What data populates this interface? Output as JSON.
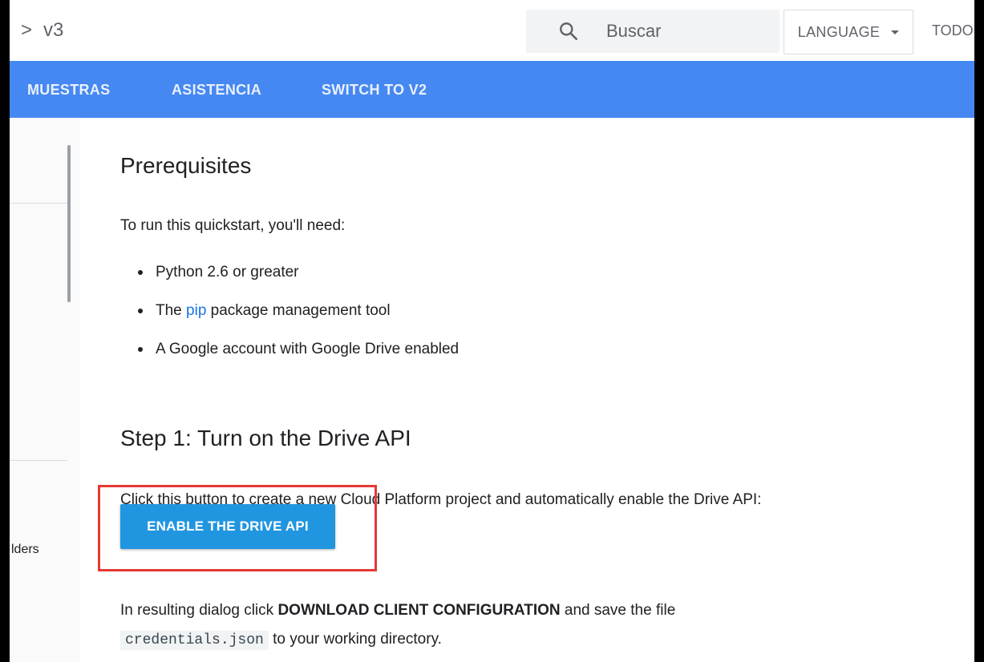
{
  "header": {
    "breadcrumb_chevron": ">",
    "breadcrumb_label": "v3",
    "search_placeholder": "Buscar",
    "language_label": "LANGUAGE",
    "overflow_label": "TODO"
  },
  "nav": {
    "tabs": [
      "MUESTRAS",
      "ASISTENCIA",
      "SWITCH TO V2"
    ]
  },
  "sidebar": {
    "partial_item": "lders"
  },
  "content": {
    "prereq_heading": "Prerequisites",
    "prereq_intro": "To run this quickstart, you'll need:",
    "bullet_1": "Python 2.6 or greater",
    "bullet_2_prefix": "The ",
    "bullet_2_link": "pip",
    "bullet_2_suffix": " package management tool",
    "bullet_3": "A Google account with Google Drive enabled",
    "step1_heading": "Step 1: Turn on the Drive API",
    "step1_text": "Click this button to create a new Cloud Platform project and automatically enable the Drive API:",
    "enable_button": "ENABLE THE DRIVE API",
    "result_prefix": "In resulting dialog click ",
    "result_bold": "DOWNLOAD CLIENT CONFIGURATION",
    "result_suffix": " and save the file",
    "file_name": "credentials.json",
    "file_suffix": " to your working directory."
  },
  "colors": {
    "nav_blue": "#4688f1",
    "button_blue": "#2196e0",
    "highlight_red": "#e53935",
    "link_blue": "#1a73e8"
  }
}
